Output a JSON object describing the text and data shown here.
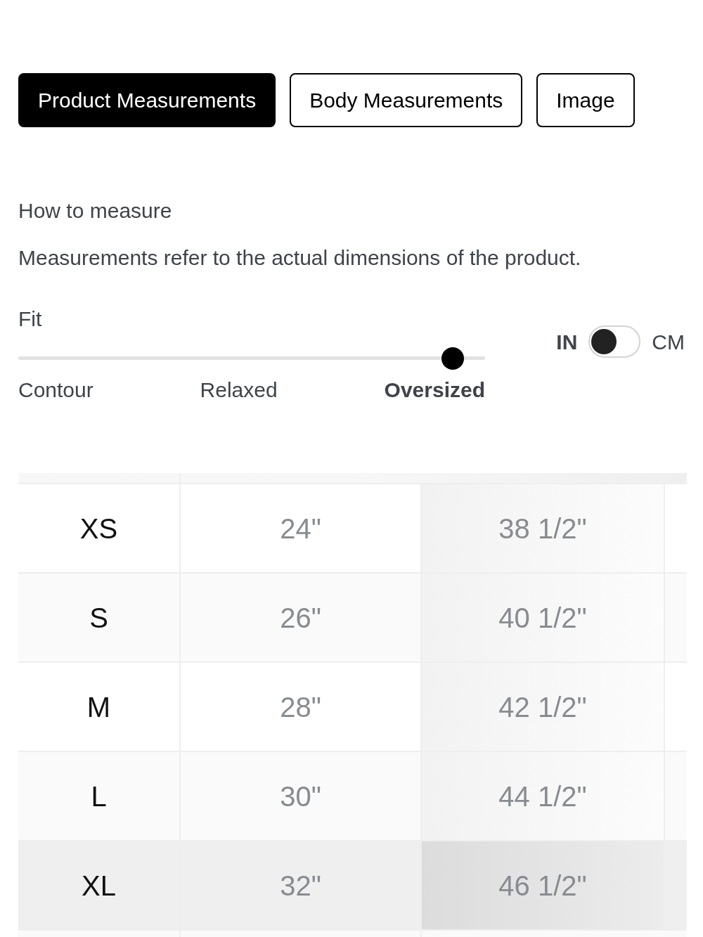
{
  "tabs": [
    {
      "label": "Product Measurements",
      "selected": true
    },
    {
      "label": "Body Measurements",
      "selected": false
    },
    {
      "label": "Image",
      "selected": false
    }
  ],
  "how_to_measure": {
    "title": "How to measure",
    "text": "Measurements refer to the actual dimensions of the product."
  },
  "fit": {
    "label": "Fit",
    "level": 0.93,
    "options": [
      {
        "label": "Contour",
        "selected": false
      },
      {
        "label": "Relaxed",
        "selected": false
      },
      {
        "label": "Oversized",
        "selected": true
      }
    ]
  },
  "units": {
    "left": "IN",
    "right": "CM",
    "on": false
  },
  "table": {
    "rows": [
      {
        "cells": [
          "XS",
          "24\"",
          "38 1/2\""
        ],
        "selected": false
      },
      {
        "cells": [
          "S",
          "26\"",
          "40 1/2\""
        ],
        "selected": false
      },
      {
        "cells": [
          "M",
          "28\"",
          "42 1/2\""
        ],
        "selected": false
      },
      {
        "cells": [
          "L",
          "30\"",
          "44 1/2\""
        ],
        "selected": false
      },
      {
        "cells": [
          "XL",
          "32\"",
          "46 1/2\""
        ],
        "selected": true
      }
    ]
  }
}
